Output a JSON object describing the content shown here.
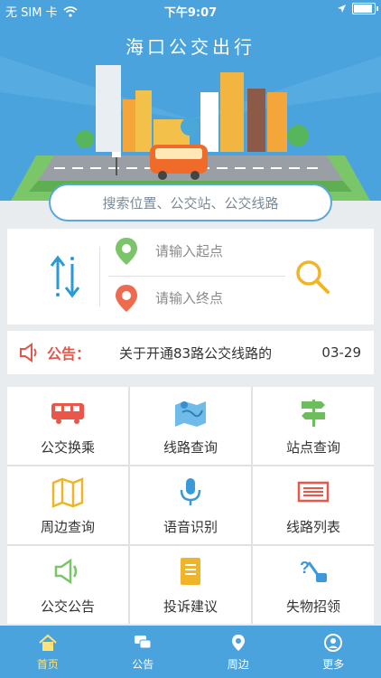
{
  "status_bar": {
    "carrier": "无 SIM 卡",
    "time": "下午9:07"
  },
  "header": {
    "title": "海口公交出行"
  },
  "search": {
    "placeholder": "搜索位置、公交站、公交线路"
  },
  "route": {
    "start_placeholder": "请输入起点",
    "end_placeholder": "请输入终点"
  },
  "notice": {
    "label": "公告：",
    "text": "关于开通83路公交线路的",
    "date": "03-29"
  },
  "features": [
    {
      "label": "公交换乘",
      "icon": "bus-icon"
    },
    {
      "label": "线路查询",
      "icon": "map-icon"
    },
    {
      "label": "站点查询",
      "icon": "signpost-icon"
    },
    {
      "label": "周边查询",
      "icon": "folded-map-icon"
    },
    {
      "label": "语音识别",
      "icon": "microphone-icon"
    },
    {
      "label": "线路列表",
      "icon": "list-icon"
    },
    {
      "label": "公交公告",
      "icon": "speaker-icon"
    },
    {
      "label": "投诉建议",
      "icon": "notebook-icon"
    },
    {
      "label": "失物招领",
      "icon": "lost-found-icon"
    }
  ],
  "tabs": [
    {
      "label": "首页",
      "icon": "home-icon"
    },
    {
      "label": "公告",
      "icon": "chat-icon"
    },
    {
      "label": "周边",
      "icon": "location-icon"
    },
    {
      "label": "更多",
      "icon": "user-icon"
    }
  ],
  "colors": {
    "primary": "#4aa3dd",
    "notice_red": "#e2574c",
    "active_tab": "#ffe27a"
  }
}
